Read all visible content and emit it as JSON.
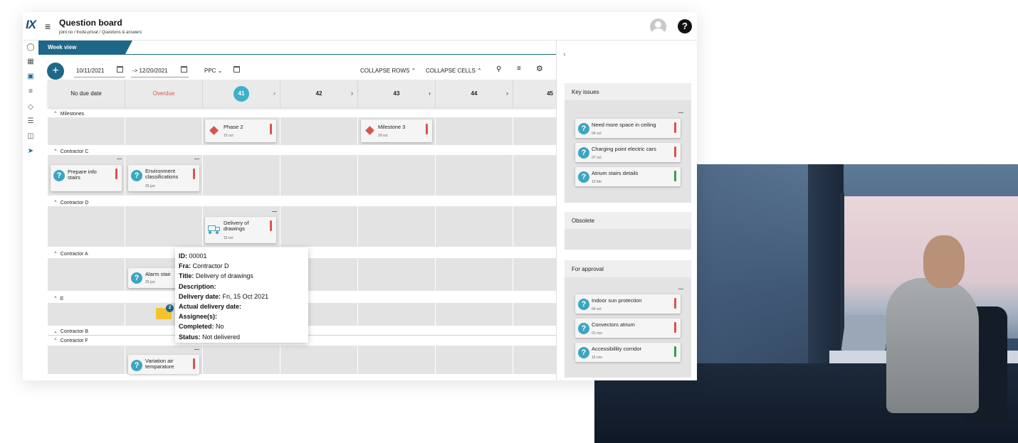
{
  "app": {
    "logo": "IX",
    "title": "Question board",
    "breadcrumb": "joint.no / frode-privat / Questions & answers",
    "help": "?"
  },
  "nav_icons": [
    "globe-icon",
    "table-icon",
    "calendar-icon",
    "checklist-icon",
    "diamond-icon",
    "list-icon",
    "truck-icon",
    "send-icon"
  ],
  "view_tab": "Week view",
  "toolbar": {
    "add": "+",
    "date_from": "10/11/2021",
    "date_to": "-> 12/20/2021",
    "ppc": "PPC",
    "collapse_rows": "COLLAPSE ROWS",
    "collapse_cells": "COLLAPSE CELLS"
  },
  "columns": {
    "no_due": "No due date",
    "overdue": "Overdue",
    "weeks": [
      "41",
      "42",
      "43",
      "44",
      "45"
    ]
  },
  "groups": {
    "milestones": "Milestones",
    "contractor_c": "Contractor C",
    "contractor_d": "Contractor D",
    "contractor_a": "Contractor A",
    "e": "E",
    "contractor_b": "Contractor B",
    "contractor_f": "Contractor F"
  },
  "cards": {
    "phase2": {
      "title": "Phase 2",
      "date": "15 oct"
    },
    "milestone3": {
      "title": "Milestone 3",
      "date": "29 oct"
    },
    "prepare": {
      "title1": "Prepare info",
      "title2": "stairs"
    },
    "environment": {
      "title1": "Environment",
      "title2": "classifications",
      "date": "25 jun"
    },
    "delivery": {
      "title1": "Delivery of",
      "title2": "drawings",
      "date": "15 oct"
    },
    "alarm": {
      "title": "Alarm stair",
      "date": "25 jun"
    },
    "folder_count": "2",
    "variation": {
      "title1": "Variation air",
      "title2": "temparature"
    }
  },
  "tooltip": {
    "id_label": "ID:",
    "id": "00001",
    "fra_label": "Fra:",
    "fra": "Contractor D",
    "title_label": "Title:",
    "title": "Delivery of drawings",
    "desc_label": "Description:",
    "delivery_label": "Delivery date:",
    "delivery": "Fri, 15 Oct 2021",
    "actual_label": "Actual delivery date:",
    "assignee_label": "Assignee(s):",
    "completed_label": "Completed:",
    "completed": "No",
    "status_label": "Status:",
    "status": "Not delivered"
  },
  "side": {
    "key_issues": {
      "title": "Key issues",
      "items": [
        {
          "title": "Need more space in ceiling",
          "date": "04 oct",
          "status": "#d9534f"
        },
        {
          "title": "Charging point electric cars",
          "date": "07 oct",
          "status": "#d9534f"
        },
        {
          "title": "Atrium stairs details",
          "date": "12 feb",
          "status": "#3a9a5b"
        }
      ]
    },
    "obsolete": {
      "title": "Obsolete"
    },
    "for_approval": {
      "title": "For approval",
      "items": [
        {
          "title": "Indoor sun protection",
          "date": "04 oct",
          "status": "#d9534f"
        },
        {
          "title": "Convectors atrium",
          "date": "01 nov",
          "status": "#d9534f"
        },
        {
          "title": "Accessibillity corridor",
          "date": "15 nov",
          "status": "#3a9a5b"
        }
      ]
    }
  },
  "colors": {
    "accent": "#1f6788",
    "question": "#3ba6c2",
    "overdue": "#d9534f",
    "ok": "#3a9a5b"
  }
}
